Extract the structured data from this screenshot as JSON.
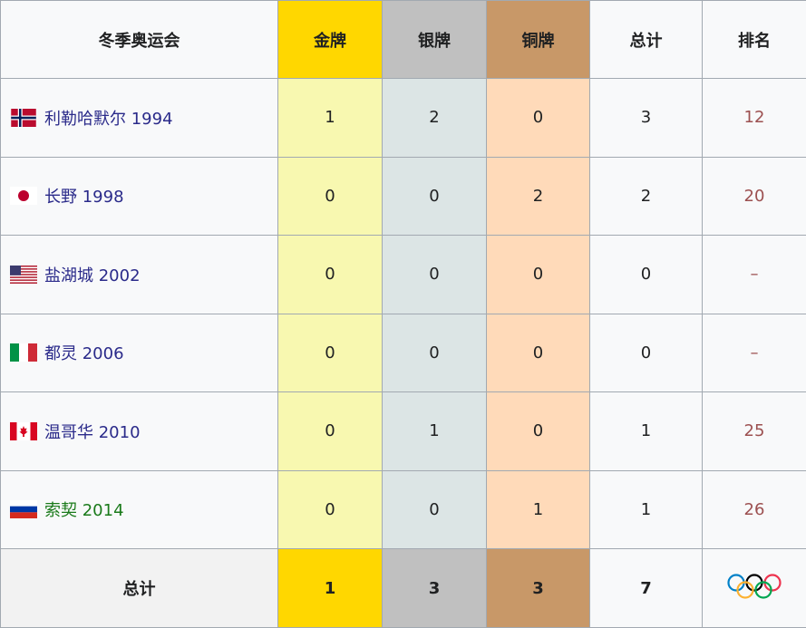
{
  "headers": {
    "games": "冬季奥运会",
    "gold": "金牌",
    "silver": "银牌",
    "bronze": "铜牌",
    "total": "总计",
    "rank": "排名"
  },
  "rows": [
    {
      "flag": "norway-flag-icon",
      "games": "利勒哈默尔 1994",
      "gold": "1",
      "silver": "2",
      "bronze": "0",
      "total": "3",
      "rank": "12"
    },
    {
      "flag": "japan-flag-icon",
      "games": "长野 1998",
      "gold": "0",
      "silver": "0",
      "bronze": "2",
      "total": "2",
      "rank": "20"
    },
    {
      "flag": "usa-flag-icon",
      "games": "盐湖城 2002",
      "gold": "0",
      "silver": "0",
      "bronze": "0",
      "total": "0",
      "rank": "–"
    },
    {
      "flag": "italy-flag-icon",
      "games": "都灵 2006",
      "gold": "0",
      "silver": "0",
      "bronze": "0",
      "total": "0",
      "rank": "–"
    },
    {
      "flag": "canada-flag-icon",
      "games": "温哥华 2010",
      "gold": "0",
      "silver": "1",
      "bronze": "0",
      "total": "1",
      "rank": "25"
    },
    {
      "flag": "russia-flag-icon",
      "games": "索契 2014",
      "gold": "0",
      "silver": "0",
      "bronze": "1",
      "total": "1",
      "rank": "26"
    }
  ],
  "footer": {
    "label": "总计",
    "gold": "1",
    "silver": "3",
    "bronze": "3",
    "total": "7",
    "icon": "olympic-rings-icon"
  },
  "colors": {
    "gold_header": "#ffd700",
    "silver_header": "#c0c0c0",
    "bronze_header": "#c89868",
    "gold_cell": "#f8f8b0",
    "silver_cell": "#dce5e5",
    "bronze_cell": "#ffdab9",
    "rank_text": "#9c5050"
  }
}
